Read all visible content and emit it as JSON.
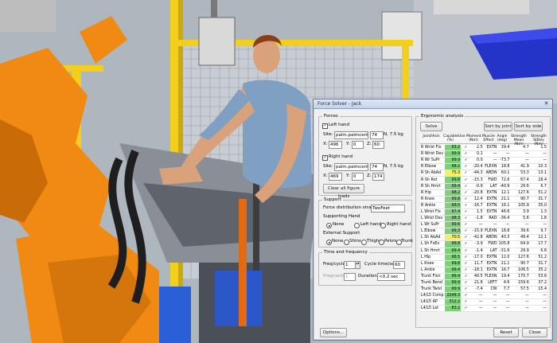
{
  "window": {
    "title": "Force Solver - Jack",
    "close_glyph": "✕"
  },
  "forces": {
    "group_label": "Forces",
    "left_hand": {
      "label": "Left hand",
      "checked": true,
      "site_label": "Site:",
      "site_value": "palm.palmcenter",
      "force_value": "74",
      "unit_label": "N, 7.5 kg",
      "x_label": "X:",
      "x_value": "496",
      "y_label": "Y:",
      "y_value": "0",
      "z_label": "Z:",
      "z_value": "60"
    },
    "right_hand": {
      "label": "Right hand",
      "checked": true,
      "site_label": "Site:",
      "site_value": "palm.palmcenter",
      "force_value": "74",
      "unit_label": "N, 7.5 kg",
      "x_label": "X:",
      "x_value": "469",
      "y_label": "Y:",
      "y_value": "0",
      "z_label": "Z:",
      "z_value": "174"
    },
    "clear_button": "Clear all figure loads"
  },
  "support": {
    "group_label": "Support",
    "strategy_label": "Force distribution strategy:",
    "strategy_value": "TwoFeet",
    "supporting_hand_label": "Supporting Hand",
    "hand_options": [
      "None",
      "Left hand",
      "Right hand"
    ],
    "hand_selected": "None",
    "external_label": "External Support",
    "external_options": [
      "None",
      "Shins",
      "Thighs",
      "Pelvis",
      "Trunk"
    ],
    "external_selected": "None"
  },
  "time": {
    "group_label": "Time and frequency",
    "freq_label": "Freq/cycle:",
    "freq_value": "1",
    "cycle_label": "Cycle time(sec):",
    "cycle_value": "60",
    "pregnant_label": "Pregnant/cycle",
    "pregnant_value": "1",
    "duration_label": "Duration:",
    "duration_value": "<0.2 sec"
  },
  "ergonomic": {
    "group_label": "Ergonomic analysis",
    "solve_button": "Solve",
    "sort_joint_button": "Sort by joint",
    "sort_side_button": "Sort by side",
    "columns": [
      "Joint/Axis",
      "Capable (%)",
      "Use",
      "Moment (Nm)",
      "Muscle Effect",
      "Angle (deg)",
      "Strength Mean (Nm)",
      "Strength StDev (Nm)"
    ],
    "rows": [
      [
        "R Wrist Flx",
        "93.2",
        "✓",
        "2.5",
        "EXTN",
        "39.4",
        "4.7",
        "1.5"
      ],
      [
        "R Wrist Dev",
        "99.9",
        "✓",
        "0.1",
        "—",
        "—",
        "—",
        "—"
      ],
      [
        "R Wr SuPr",
        "99.9",
        "✓",
        "0.0",
        "—",
        "-73.7",
        "—",
        "—"
      ],
      [
        "R Elbow",
        "98.2",
        "✓",
        "-20.4",
        "FLEXN",
        "18.8",
        "41.9",
        "10.3"
      ],
      [
        "R Sh AbAd",
        "75.3",
        "✓",
        "-44.3",
        "ABDN",
        "60.1",
        "53.3",
        "13.1"
      ],
      [
        "R Sh Rot",
        "99.8",
        "✓",
        "-15.3",
        "FWD",
        "72.6",
        "67.4",
        "18.4"
      ],
      [
        "R Sh Hmrt",
        "99.4",
        "✓",
        "-0.9",
        "LAT",
        "-40.9",
        "29.6",
        "6.7"
      ],
      [
        "R Hip",
        "98.2",
        "✓",
        "-20.8",
        "EXTN",
        "12.1",
        "127.6",
        "51.2"
      ],
      [
        "R Knee",
        "99.8",
        "✓",
        "12.4",
        "EXTN",
        "21.1",
        "90.7",
        "31.7"
      ],
      [
        "R Ankle",
        "99.5",
        "✓",
        "-16.7",
        "EXTN",
        "16.1",
        "105.9",
        "35.0"
      ],
      [
        "L Wrist Flx",
        "97.4",
        "✓",
        "1.5",
        "EXTN",
        "46.6",
        "3.9",
        "1.3"
      ],
      [
        "L Wrist Dev",
        "98.3",
        "✓",
        "-1.8",
        "RAD",
        "-36.4",
        "5.6",
        "1.8"
      ],
      [
        "L Wr SuPr",
        "99.6",
        "✓",
        "—",
        "—",
        "—",
        "—",
        "—"
      ],
      [
        "L Elbow",
        "99.3",
        "✓",
        "-15.9",
        "FLEXN",
        "18.8",
        "39.6",
        "9.7"
      ],
      [
        "L Sh AbAd",
        "70.5",
        "✓",
        "-42.8",
        "ABDN",
        "40.3",
        "49.4",
        "12.1"
      ],
      [
        "L Sh FxEx",
        "99.8",
        "✓",
        "-3.9",
        "FWD",
        "105.8",
        "64.9",
        "17.7"
      ],
      [
        "L Sh Hmrt",
        "99.4",
        "✓",
        "-1.4",
        "LAT",
        "-31.6",
        "29.9",
        "6.8"
      ],
      [
        "L Hip",
        "98.5",
        "✓",
        "-17.0",
        "EXTN",
        "12.0",
        "127.6",
        "51.2"
      ],
      [
        "L Knee",
        "99.8",
        "✓",
        "11.7",
        "EXTN",
        "21.1",
        "90.7",
        "31.7"
      ],
      [
        "L Ankle",
        "99.4",
        "✓",
        "-18.1",
        "EXTN",
        "16.7",
        "106.5",
        "35.2"
      ],
      [
        "Trunk Flxn",
        "99.4",
        "✓",
        "40.5",
        "FLEXN",
        "19.4",
        "170.7",
        "53.6"
      ],
      [
        "Trunk Bend",
        "99.9",
        "✓",
        "21.8",
        "LEFT",
        "4.6",
        "159.6",
        "37.2"
      ],
      [
        "Trunk Twist",
        "99.9",
        "✓",
        "-7.4",
        "CW",
        "7.7",
        "57.5",
        "15.4"
      ],
      [
        "L4/L5 Comp",
        "2249.3",
        "✓",
        "—",
        "—",
        "—",
        "—",
        "—"
      ],
      [
        "L4/L5 AP",
        "312.2",
        "✓",
        "—",
        "—",
        "—",
        "—",
        "—"
      ],
      [
        "L4/L5 Lat",
        "83.2",
        "✓",
        "—",
        "—",
        "—",
        "—",
        "—"
      ]
    ],
    "yellow_rows": [
      4,
      14
    ]
  },
  "footer": {
    "options_button": "Options...",
    "reset_button": "Reset",
    "close_button": "Close"
  }
}
